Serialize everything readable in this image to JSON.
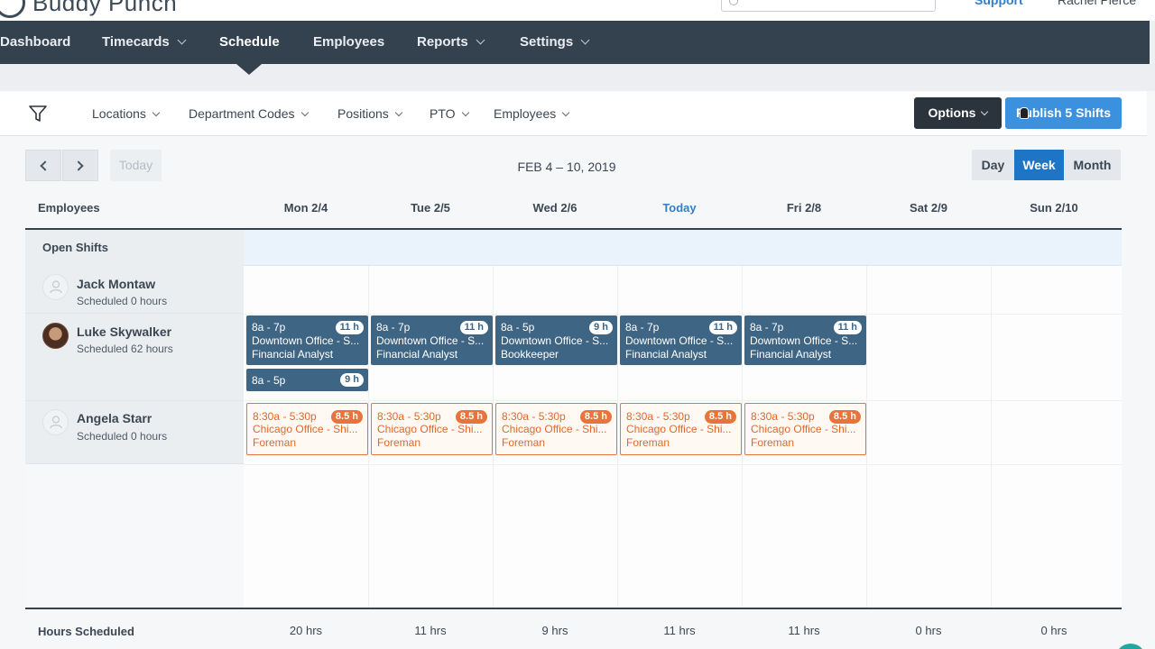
{
  "brand": {
    "logo_text": "Buddy Punch"
  },
  "header": {
    "support_label": "Support",
    "user_name": "Rachel Pierce"
  },
  "nav": {
    "items": [
      {
        "label": "Dashboard",
        "has_caret": false
      },
      {
        "label": "Timecards",
        "has_caret": true
      },
      {
        "label": "Schedule",
        "has_caret": false,
        "active": true
      },
      {
        "label": "Employees",
        "has_caret": false
      },
      {
        "label": "Reports",
        "has_caret": true
      },
      {
        "label": "Settings",
        "has_caret": true
      }
    ]
  },
  "filters": {
    "items": [
      "Locations",
      "Department Codes",
      "Positions",
      "PTO",
      "Employees"
    ],
    "options_label": "Options",
    "publish_label": "Publish 5 Shifts"
  },
  "toolbar": {
    "today_label": "Today",
    "date_range": "FEB 4 – 10, 2019",
    "views": [
      "Day",
      "Week",
      "Month"
    ],
    "active_view": "Week"
  },
  "grid": {
    "employees_header": "Employees",
    "columns": [
      "Mon 2/4",
      "Tue 2/5",
      "Wed 2/6",
      "Today",
      "Fri 2/8",
      "Sat 2/9",
      "Sun 2/10"
    ],
    "today_index": 3,
    "open_shifts_label": "Open Shifts"
  },
  "employees": [
    {
      "name": "Jack Montaw",
      "scheduled": "Scheduled 0 hours",
      "avatar": "user-placeholder-icon"
    },
    {
      "name": "Luke Skywalker",
      "scheduled": "Scheduled 62 hours",
      "avatar": "photo"
    },
    {
      "name": "Angela Starr",
      "scheduled": "Scheduled 0 hours",
      "avatar": "user-placeholder-icon"
    }
  ],
  "shifts": {
    "luke": [
      {
        "day": 0,
        "time": "8a - 7p",
        "hours": "11 h",
        "location": "Downtown Office - S...",
        "position": "Financial Analyst"
      },
      {
        "day": 1,
        "time": "8a - 7p",
        "hours": "11 h",
        "location": "Downtown Office - S...",
        "position": "Financial Analyst"
      },
      {
        "day": 2,
        "time": "8a - 5p",
        "hours": "9 h",
        "location": "Downtown Office - S...",
        "position": "Bookkeeper"
      },
      {
        "day": 3,
        "time": "8a - 7p",
        "hours": "11 h",
        "location": "Downtown Office - S...",
        "position": "Financial Analyst"
      },
      {
        "day": 4,
        "time": "8a - 7p",
        "hours": "11 h",
        "location": "Downtown Office - S...",
        "position": "Financial Analyst"
      }
    ],
    "luke_extra": {
      "day": 0,
      "time": "8a - 5p",
      "hours": "9 h"
    },
    "angela": [
      {
        "day": 0,
        "time": "8:30a - 5:30p",
        "hours": "8.5 h",
        "location": "Chicago Office - Shi...",
        "position": "Foreman"
      },
      {
        "day": 1,
        "time": "8:30a - 5:30p",
        "hours": "8.5 h",
        "location": "Chicago Office - Shi...",
        "position": "Foreman"
      },
      {
        "day": 2,
        "time": "8:30a - 5:30p",
        "hours": "8.5 h",
        "location": "Chicago Office - Shi...",
        "position": "Foreman"
      },
      {
        "day": 3,
        "time": "8:30a - 5:30p",
        "hours": "8.5 h",
        "location": "Chicago Office - Shi...",
        "position": "Foreman"
      },
      {
        "day": 4,
        "time": "8:30a - 5:30p",
        "hours": "8.5 h",
        "location": "Chicago Office - Shi...",
        "position": "Foreman"
      }
    ]
  },
  "footer": {
    "label": "Hours Scheduled",
    "values": [
      "20 hrs",
      "11 hrs",
      "9 hrs",
      "11 hrs",
      "11 hrs",
      "0 hrs",
      "0 hrs"
    ]
  },
  "colors": {
    "nav_bg": "#34414e",
    "accent_blue": "#3c91de",
    "shift_blue": "#3e6684",
    "shift_orange": "#e8743b",
    "today_blue": "#2f7fc9"
  }
}
